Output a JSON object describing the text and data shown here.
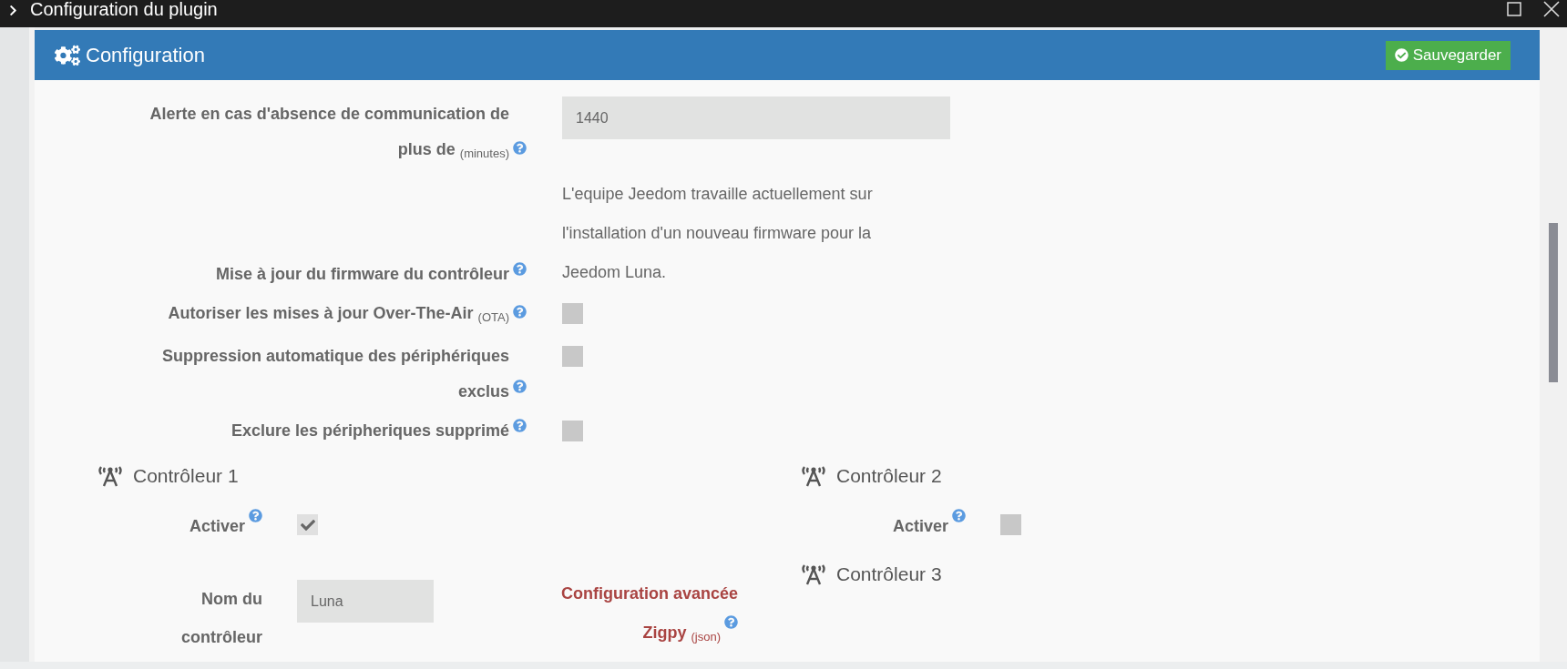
{
  "window": {
    "title": "Configuration du plugin"
  },
  "panel": {
    "title": "Configuration",
    "save_button": "Sauvegarder"
  },
  "settings": [
    {
      "kind": "input",
      "label": "Alerte en cas d'absence de communication de plus de $_{(minutes)}$",
      "value": "1440"
    },
    {
      "kind": "text",
      "label": "Mise à jour du firmware du contrôleur",
      "text": "L'equipe Jeedom travaille actuellement sur l'installation d'un nouveau firmware pour la Jeedom Luna."
    },
    {
      "kind": "checkbox",
      "label": "Autoriser les mises à jour Over-The-Air $_{(OTA)}$",
      "checked": false
    },
    {
      "kind": "checkbox",
      "label": "Suppression automatique des périphériques exclus",
      "checked": false
    },
    {
      "kind": "checkbox",
      "label": "Exclure les péripheriques supprimé",
      "checked": false
    }
  ],
  "controllers": [
    {
      "title": "Contrôleur 1",
      "activate": {
        "label": "Activer",
        "checked": true
      },
      "name_field": {
        "label": "Nom du contrôleur",
        "value": "Luna"
      },
      "advanced_link": "Configuration avancée Zigpy $_{(json)}$"
    },
    {
      "title": "Contrôleur 2",
      "activate": {
        "label": "Activer",
        "checked": false
      }
    },
    {
      "title": "Contrôleur 3"
    }
  ]
}
